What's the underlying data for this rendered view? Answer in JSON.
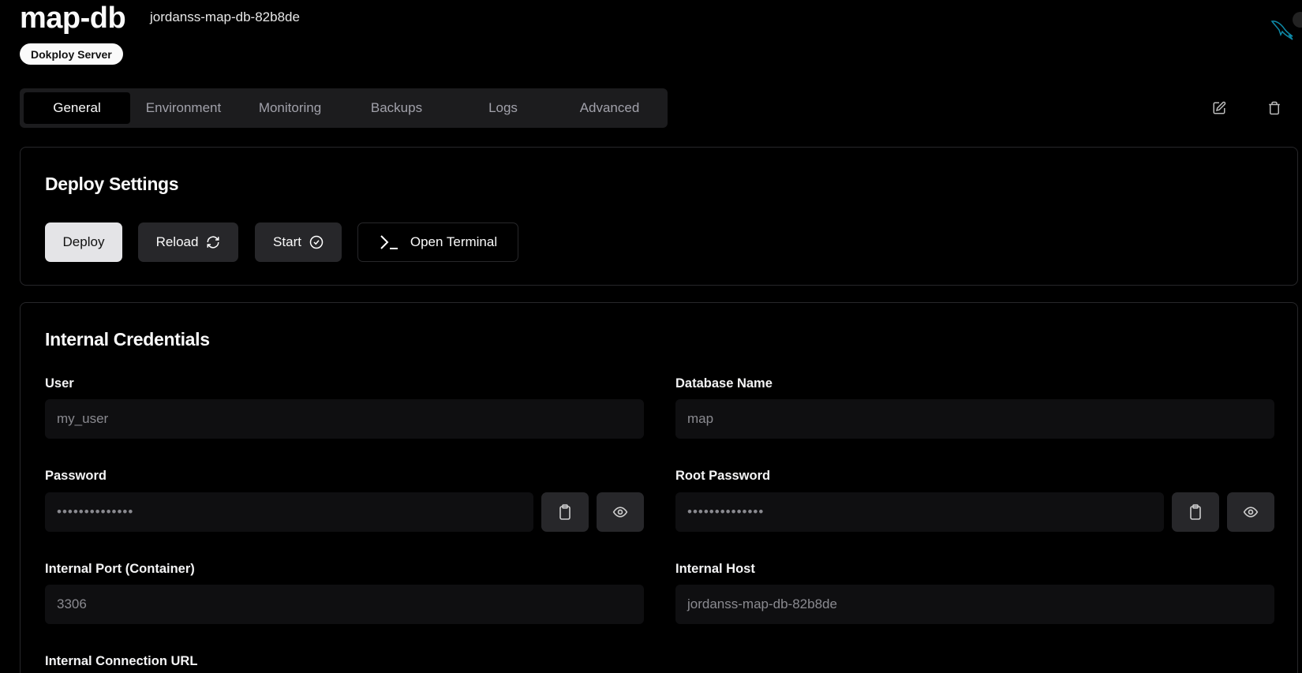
{
  "header": {
    "title": "map-db",
    "app_name": "jordanss-map-db-82b8de",
    "server_badge": "Dokploy Server",
    "db_icon": "mysql-dolphin-icon",
    "accent": "#0e8aa8"
  },
  "tabs": [
    {
      "label": "General"
    },
    {
      "label": "Environment"
    },
    {
      "label": "Monitoring"
    },
    {
      "label": "Backups"
    },
    {
      "label": "Logs"
    },
    {
      "label": "Advanced"
    }
  ],
  "deploy": {
    "title": "Deploy Settings",
    "deploy": "Deploy",
    "reload": "Reload",
    "start": "Start",
    "terminal": "Open Terminal"
  },
  "credentials": {
    "title": "Internal Credentials",
    "user_label": "User",
    "user_value": "my_user",
    "dbname_label": "Database Name",
    "dbname_value": "map",
    "password_label": "Password",
    "password_value": "••••••••••••••",
    "root_password_label": "Root Password",
    "root_password_value": "••••••••••••••",
    "port_label": "Internal Port (Container)",
    "port_value": "3306",
    "host_label": "Internal Host",
    "host_value": "jordanss-map-db-82b8de",
    "url_label": "Internal Connection URL"
  }
}
